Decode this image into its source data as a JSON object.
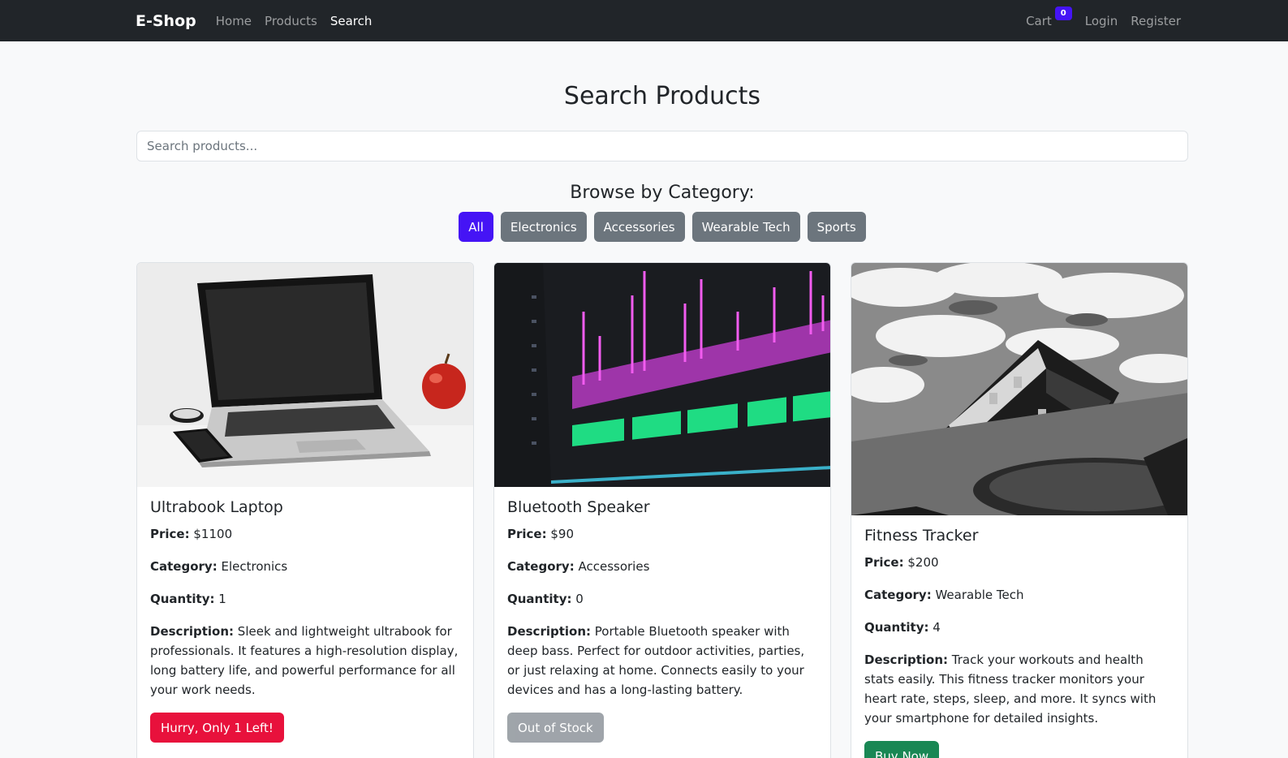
{
  "nav": {
    "brand": "E-Shop",
    "links": [
      "Home",
      "Products",
      "Search"
    ],
    "cart_label": "Cart",
    "cart_count": "0",
    "login": "Login",
    "register": "Register"
  },
  "page": {
    "title": "Search Products",
    "search_placeholder": "Search products...",
    "browse_title": "Browse by Category:",
    "categories": [
      "All",
      "Electronics",
      "Accessories",
      "Wearable Tech",
      "Sports"
    ],
    "active_category": "All"
  },
  "labels": {
    "price": "Price:",
    "category": "Category:",
    "quantity": "Quantity:",
    "description": "Description:"
  },
  "products": [
    {
      "name": "Ultrabook Laptop",
      "price": "$1100",
      "category": "Electronics",
      "quantity": "1",
      "description": "Sleek and lightweight ultrabook for professionals. It features a high-resolution display, long battery life, and powerful performance for all your work needs.",
      "action": "Hurry, Only 1 Left!"
    },
    {
      "name": "Bluetooth Speaker",
      "price": "$90",
      "category": "Accessories",
      "quantity": "0",
      "description": "Portable Bluetooth speaker with deep bass. Perfect for outdoor activities, parties, or just relaxing at home. Connects easily to your devices and has a long-lasting battery.",
      "action": "Out of Stock"
    },
    {
      "name": "Fitness Tracker",
      "price": "$200",
      "category": "Wearable Tech",
      "quantity": "4",
      "description": "Track your workouts and health stats easily. This fitness tracker monitors your heart rate, steps, sleep, and more. It syncs with your smartphone for detailed insights.",
      "action": "Buy Now"
    }
  ],
  "colors": {
    "navbar": "#212529",
    "accent": "#4514f5",
    "danger": "#e8113c",
    "secondary": "#6c757d",
    "success": "#198754"
  }
}
